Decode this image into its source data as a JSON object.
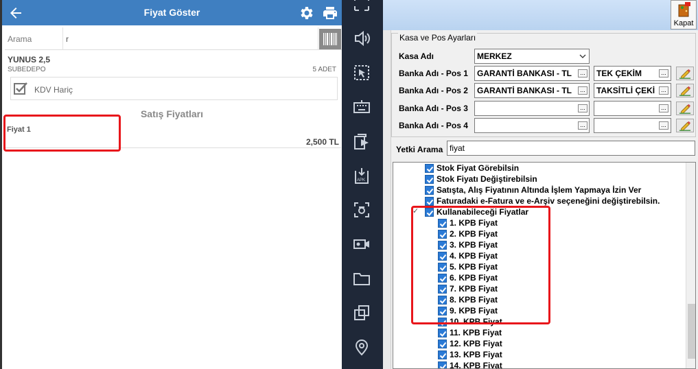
{
  "phone": {
    "title": "Fiyat Göster",
    "search_label": "Arama",
    "search_value": "r",
    "product_name": "YUNUS 2,5",
    "depot": "SUBEDEPO",
    "quantity": "5 ADET",
    "kdv_label": "KDV Hariç",
    "prices_heading": "Satış Fiyatları",
    "price_name": "Fiyat 1",
    "price_value": "2,500 TL"
  },
  "nav": {
    "icons": [
      "fullscreen-icon",
      "volume-icon",
      "pointer-icon",
      "keyboard-icon",
      "screen-share-icon",
      "apk-install-icon",
      "screenshot-icon",
      "screen-record-icon",
      "folder-icon",
      "multi-window-icon",
      "location-icon"
    ]
  },
  "desktop": {
    "close_label": "Kapat",
    "group_title": "Kasa ve Pos Ayarları",
    "kasa_label": "Kasa Adı",
    "kasa_value": "MERKEZ",
    "pos_rows": [
      {
        "label": "Banka Adı - Pos 1",
        "bank": "GARANTİ BANKASI - TL",
        "type": "TEK ÇEKİM"
      },
      {
        "label": "Banka Adı - Pos 2",
        "bank": "GARANTİ BANKASI - TL",
        "type": "TAKSİTLİ ÇEKİ"
      },
      {
        "label": "Banka Adı - Pos 3",
        "bank": "",
        "type": ""
      },
      {
        "label": "Banka Adı - Pos 4",
        "bank": "",
        "type": ""
      }
    ],
    "ellipsis": "...",
    "yetki_label": "Yetki Arama",
    "yetki_value": "fiyat",
    "tree": [
      {
        "text": "Stok Fiyat Görebilsin",
        "level": 1
      },
      {
        "text": "Stok Fiyatı Değiştirebilsin",
        "level": 1
      },
      {
        "text": "Satışta, Alış Fiyatının Altında İşlem Yapmaya İzin Ver",
        "level": 1
      },
      {
        "text": "Faturadaki e-Fatura ve e-Arşiv  seçeneğini değiştirebilsin.",
        "level": 1
      },
      {
        "text": "Kullanabileceği Fiyatlar",
        "level": 1,
        "expander": "✓"
      },
      {
        "text": "1. KPB Fiyat",
        "level": 2
      },
      {
        "text": "2. KPB Fiyat",
        "level": 2
      },
      {
        "text": "3. KPB Fiyat",
        "level": 2
      },
      {
        "text": "4. KPB Fiyat",
        "level": 2
      },
      {
        "text": "5. KPB Fiyat",
        "level": 2
      },
      {
        "text": "6. KPB Fiyat",
        "level": 2
      },
      {
        "text": "7. KPB Fiyat",
        "level": 2
      },
      {
        "text": "8. KPB Fiyat",
        "level": 2
      },
      {
        "text": "9. KPB Fiyat",
        "level": 2
      },
      {
        "text": "10. KPB Fiyat",
        "level": 2
      },
      {
        "text": "11. KPB Fiyat",
        "level": 2
      },
      {
        "text": "12. KPB Fiyat",
        "level": 2
      },
      {
        "text": "13. KPB Fiyat",
        "level": 2
      },
      {
        "text": "14. KPB Fiyat",
        "level": 2
      }
    ]
  },
  "colors": {
    "appbar": "#3f7fc1",
    "nav_bg": "#1f2838",
    "highlight": "#e8161b",
    "checkbox": "#2a7ad6"
  }
}
